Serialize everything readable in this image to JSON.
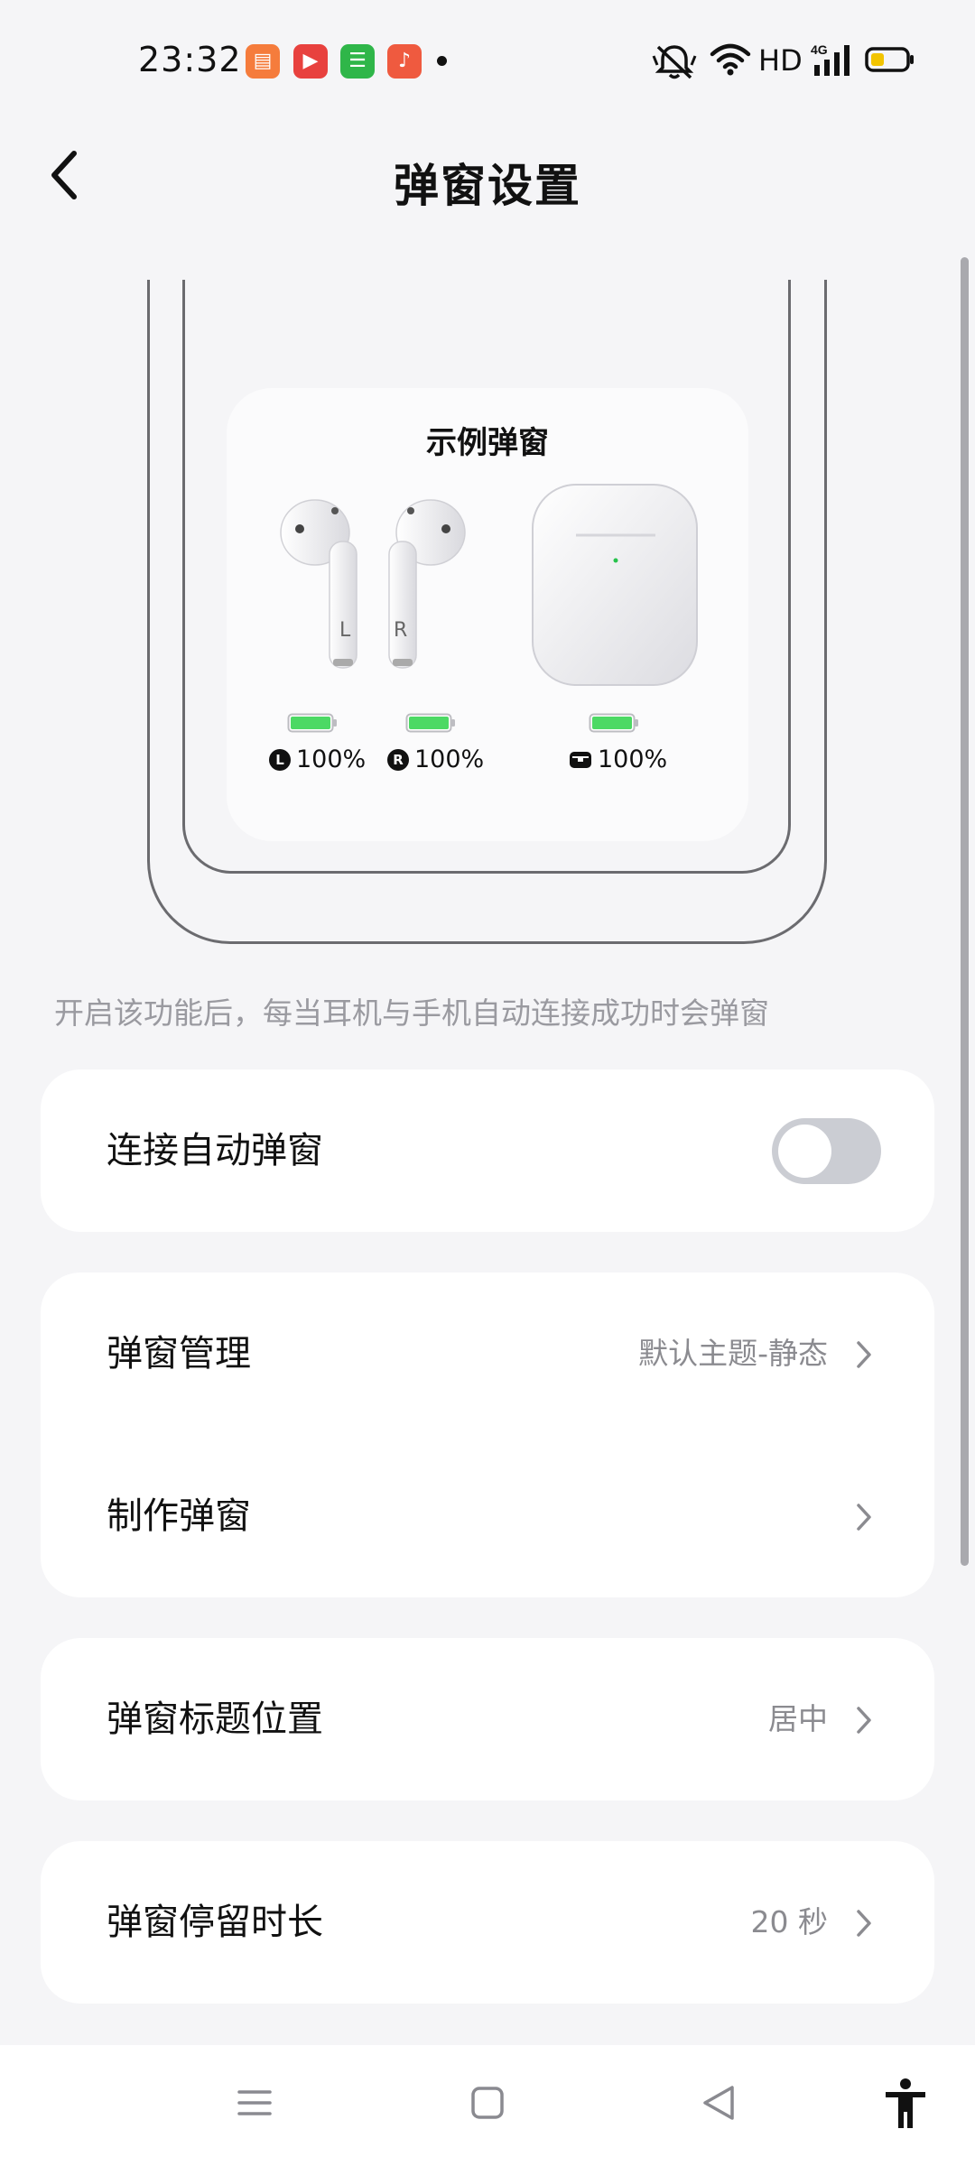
{
  "status_bar": {
    "time": "23:32",
    "network_label": "HD",
    "apps": [
      {
        "icon": "book-app-icon",
        "color": "#f57c3c",
        "glyph": "▤"
      },
      {
        "icon": "video-app-icon",
        "color": "#e8413e",
        "glyph": "▶"
      },
      {
        "icon": "shopping-app-icon",
        "color": "#2fb649",
        "glyph": "☰"
      },
      {
        "icon": "music-app-icon",
        "color": "#ef5a3f",
        "glyph": "♪"
      }
    ],
    "battery_color": "#f2c400"
  },
  "header": {
    "title": "弹窗设置"
  },
  "preview": {
    "popup_title": "示例弹窗",
    "left_bud": {
      "letter": "L",
      "badge": "L",
      "percent": "100%"
    },
    "right_bud": {
      "letter": "R",
      "badge": "R",
      "percent": "100%"
    },
    "case": {
      "percent": "100%"
    },
    "battery_color": "#4cd964"
  },
  "hint_text": "开启该功能后，每当耳机与手机自动连接成功时会弹窗",
  "settings": {
    "auto_popup": {
      "label": "连接自动弹窗",
      "enabled": false
    },
    "popup_manage": {
      "label": "弹窗管理",
      "value": "默认主题-静态"
    },
    "make_popup": {
      "label": "制作弹窗"
    },
    "title_position": {
      "label": "弹窗标题位置",
      "value": "居中"
    },
    "duration": {
      "label": "弹窗停留时长",
      "value": "20 秒"
    }
  }
}
